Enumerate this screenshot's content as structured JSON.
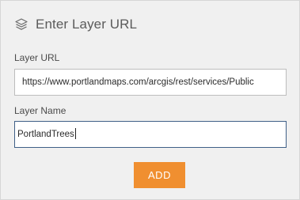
{
  "header": {
    "icon": "layers-icon",
    "title": "Enter Layer URL"
  },
  "layer_url": {
    "label": "Layer URL",
    "value": "https://www.portlandmaps.com/arcgis/rest/services/Public"
  },
  "layer_name": {
    "label": "Layer Name",
    "value": "PortlandTrees"
  },
  "actions": {
    "add_label": "ADD"
  },
  "colors": {
    "panel_background": "#f0f0f0",
    "button_background": "#f08f30",
    "focused_border": "#3f5f87"
  }
}
